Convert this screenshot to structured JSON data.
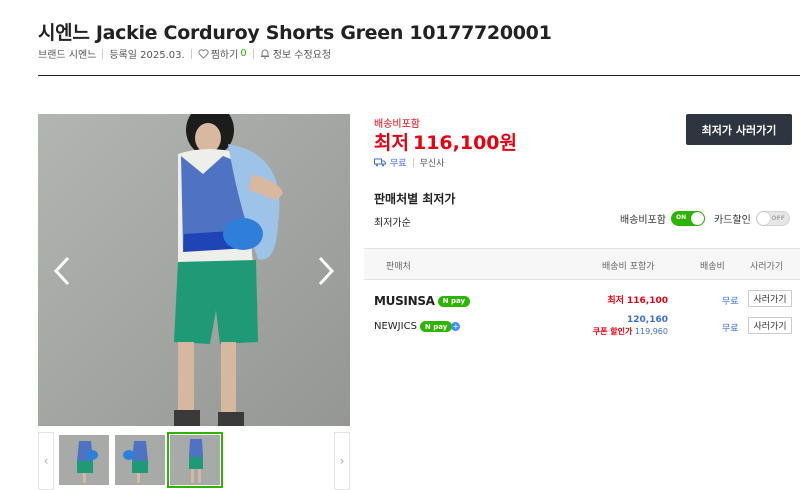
{
  "product": {
    "title": "시엔느 Jackie Corduroy Shorts Green 10177720001",
    "brand": "브랜드 시엔느",
    "registered": "등록일 2025.03.",
    "wish_label": "찜하기",
    "wish_count": "0",
    "report": "정보 수정요청"
  },
  "pricing": {
    "shipping_included": "배송비포함",
    "lowest_prefix": "최저",
    "lowest_price": "116,100원",
    "shipping_free": "무료",
    "mall": "무신사",
    "buy_button": "최저가 사러가기"
  },
  "sellers_section": {
    "title": "판매처별 최저가",
    "sort": "최저가순",
    "toggle_shipping_label": "배송비포함",
    "toggle_shipping_state": "ON",
    "toggle_card_label": "카드할인",
    "toggle_card_state": "OFF",
    "columns": [
      "판매처",
      "배송비 포함가",
      "배송비",
      "사러가기"
    ],
    "rows": [
      {
        "seller": "MUSINSA",
        "badge": "npay",
        "price_label": "최저 116,100",
        "shipping": "무료",
        "action": "사러가기"
      },
      {
        "seller": "NEWJICS",
        "badge": "npay+",
        "price": "120,160",
        "coupon_label": "쿠폰 할인가",
        "coupon_price": "119,960",
        "shipping": "무료",
        "action": "사러가기"
      }
    ]
  },
  "gallery": {
    "thumbnail_count": 3,
    "selected_index": 2
  },
  "colors": {
    "accent_red": "#e60012",
    "naver_green": "#2db400",
    "dark_button": "#2d3640",
    "link_blue": "#3a6fd8"
  }
}
